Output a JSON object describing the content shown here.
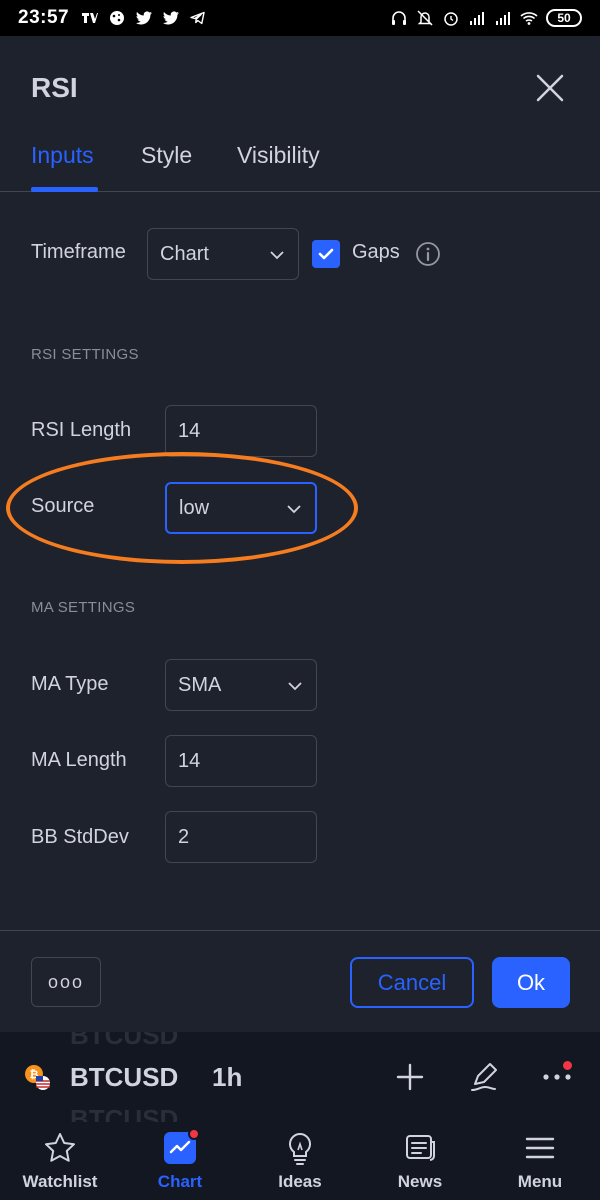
{
  "status_bar": {
    "time": "23:57",
    "battery": "50",
    "left_icons": [
      "tradingview-icon",
      "cookie-icon",
      "twitter-icon",
      "twitter-icon",
      "telegram-icon"
    ],
    "right_icons": [
      "headphones-icon",
      "mute-icon",
      "alarm-icon",
      "signal-icon",
      "signal-icon",
      "wifi-icon"
    ]
  },
  "dialog": {
    "title": "RSI",
    "tabs": [
      {
        "label": "Inputs",
        "active": true
      },
      {
        "label": "Style",
        "active": false
      },
      {
        "label": "Visibility",
        "active": false
      }
    ],
    "timeframe": {
      "label": "Timeframe",
      "value": "Chart",
      "gaps_label": "Gaps",
      "gaps_checked": true
    },
    "rsi_section": {
      "header": "RSI SETTINGS",
      "length_label": "RSI Length",
      "length_value": "14",
      "source_label": "Source",
      "source_value": "low"
    },
    "ma_section": {
      "header": "MA SETTINGS",
      "type_label": "MA Type",
      "type_value": "SMA",
      "length_label": "MA Length",
      "length_value": "14",
      "bb_label": "BB StdDev",
      "bb_value": "2"
    },
    "footer": {
      "more_label": "ooo",
      "cancel_label": "Cancel",
      "ok_label": "Ok"
    }
  },
  "symbol_bar": {
    "symbol": "BTCUSD",
    "interval": "1h",
    "ghost_top": "BTCUSD",
    "ghost_bottom": "BTCUSD"
  },
  "bottom_nav": {
    "items": [
      {
        "label": "Watchlist",
        "icon": "star-icon",
        "active": false
      },
      {
        "label": "Chart",
        "icon": "chart-icon",
        "active": true
      },
      {
        "label": "Ideas",
        "icon": "lightbulb-icon",
        "active": false
      },
      {
        "label": "News",
        "icon": "news-icon",
        "active": false
      },
      {
        "label": "Menu",
        "icon": "menu-icon",
        "active": false
      }
    ]
  },
  "colors": {
    "accent": "#2962ff",
    "highlight": "#f57c1f",
    "dialog_bg": "#1e222d",
    "notification": "#f23645"
  }
}
